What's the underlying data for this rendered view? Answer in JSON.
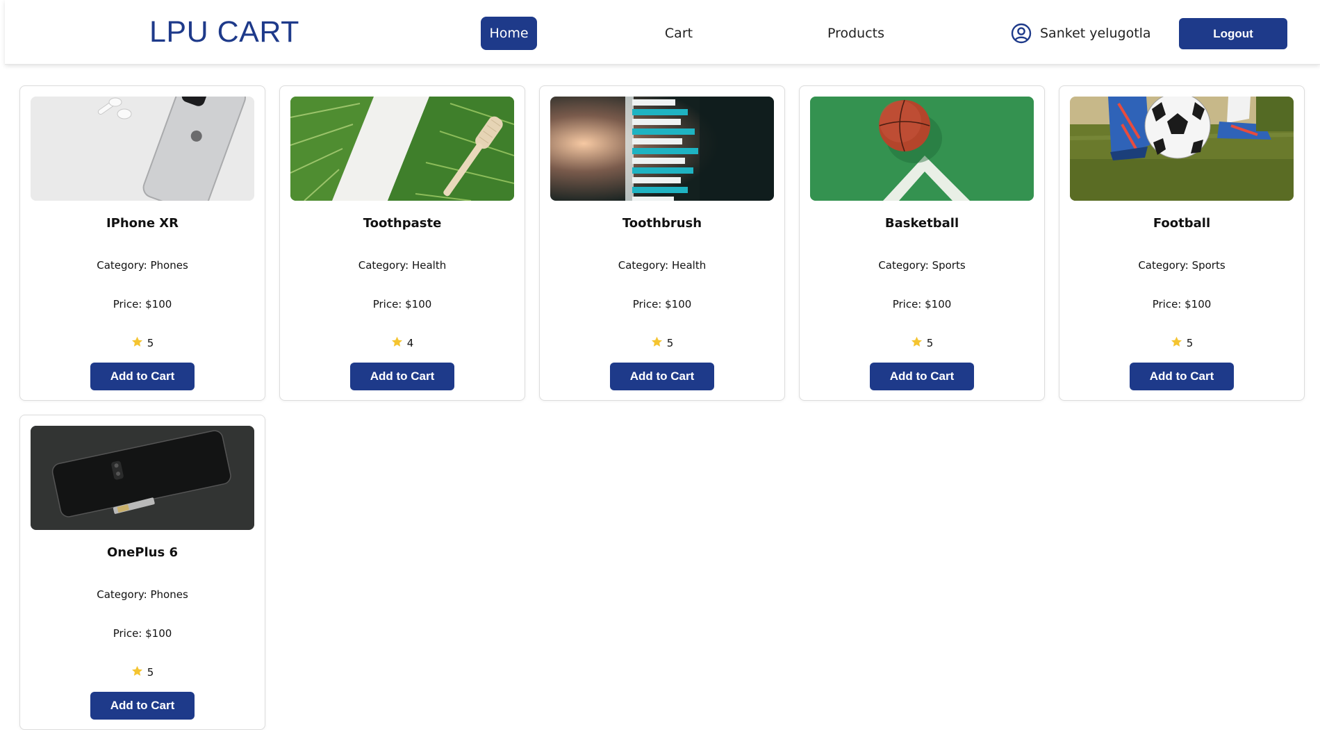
{
  "header": {
    "brand": "LPU CART",
    "nav": {
      "home": "Home",
      "cart": "Cart",
      "products": "Products"
    },
    "user": {
      "name": "Sanket yelugotla",
      "icon": "user-circle-icon"
    },
    "logout_label": "Logout"
  },
  "colors": {
    "accent": "#1e3a8a",
    "star": "#f4c430"
  },
  "products": [
    {
      "title": "IPhone XR",
      "category": "Category: Phones",
      "price": "Price: $100",
      "rating": "5",
      "add_label": "Add to Cart",
      "image": "iphone-image"
    },
    {
      "title": "Toothpaste",
      "category": "Category: Health",
      "price": "Price: $100",
      "rating": "4",
      "add_label": "Add to Cart",
      "image": "toothpaste-image"
    },
    {
      "title": "Toothbrush",
      "category": "Category: Health",
      "price": "Price: $100",
      "rating": "5",
      "add_label": "Add to Cart",
      "image": "toothbrush-image"
    },
    {
      "title": "Basketball",
      "category": "Category: Sports",
      "price": "Price: $100",
      "rating": "5",
      "add_label": "Add to Cart",
      "image": "basketball-image"
    },
    {
      "title": "Football",
      "category": "Category: Sports",
      "price": "Price: $100",
      "rating": "5",
      "add_label": "Add to Cart",
      "image": "football-image"
    },
    {
      "title": "OnePlus 6",
      "category": "Category: Phones",
      "price": "Price: $100",
      "rating": "5",
      "add_label": "Add to Cart",
      "image": "oneplus-image"
    }
  ]
}
